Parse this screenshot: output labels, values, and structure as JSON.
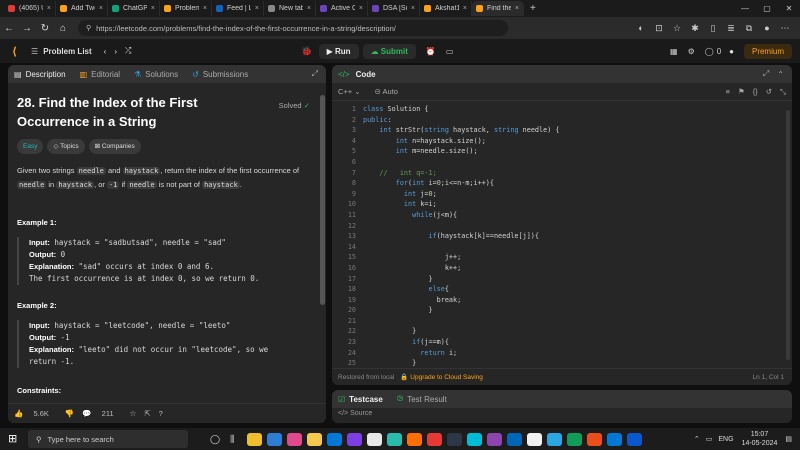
{
  "browser": {
    "tabs": [
      {
        "label": "(4065) US Cl",
        "color": "#e53935"
      },
      {
        "label": "Add Two N",
        "color": "#ffa116"
      },
      {
        "label": "ChatGPT",
        "color": "#10a37f"
      },
      {
        "label": "Problems",
        "color": "#ffa116"
      },
      {
        "label": "Feed | Linke",
        "color": "#0a66c2"
      },
      {
        "label": "New tab",
        "color": "#888888"
      },
      {
        "label": "Active Cou",
        "color": "#6f42c1"
      },
      {
        "label": "DSA [Supe",
        "color": "#6f42c1"
      },
      {
        "label": "Akshat1 Fro",
        "color": "#ffa116"
      },
      {
        "label": "Find the In",
        "color": "#ffa116"
      }
    ],
    "url": "https://leetcode.com/problems/find-the-index-of-the-first-occurrence-in-a-string/description/"
  },
  "header": {
    "problem_list": "Problem List",
    "run": "Run",
    "submit": "Submit",
    "premium": "Premium",
    "count": "0"
  },
  "left_panel": {
    "tabs": [
      "Description",
      "Editorial",
      "Solutions",
      "Submissions"
    ],
    "title": "28. Find the Index of the First Occurrence in a String",
    "solved": "Solved",
    "chips": [
      "Easy",
      "Topics",
      "Companies"
    ],
    "desc_parts": {
      "p1": "Given two strings ",
      "c1": "needle",
      "p2": " and ",
      "c2": "haystack",
      "p3": ", return the index of the first occurrence of ",
      "c3": "needle",
      "p4": " in ",
      "c4": "haystack",
      "p5": ", or ",
      "c5": "-1",
      "p6": " if ",
      "c6": "needle",
      "p7": " is not part of ",
      "c7": "haystack",
      "p8": "."
    },
    "example1": {
      "heading": "Example 1:",
      "input_label": "Input:",
      "input": "haystack = \"sadbutsad\", needle = \"sad\"",
      "output_label": "Output:",
      "output": "0",
      "explanation_label": "Explanation:",
      "explanation": "\"sad\" occurs at index 0 and 6.",
      "explanation2": "The first occurrence is at index 0, so we return 0."
    },
    "example2": {
      "heading": "Example 2:",
      "input_label": "Input:",
      "input": "haystack = \"leetcode\", needle = \"leeto\"",
      "output_label": "Output:",
      "output": "-1",
      "explanation_label": "Explanation:",
      "explanation": "\"leeto\" did not occur in \"leetcode\", so we",
      "explanation2": "return -1."
    },
    "constraints": "Constraints:",
    "likes": "5.6K",
    "comments": "211"
  },
  "code_panel": {
    "tab": "Code",
    "language": "C++",
    "mode": "Auto",
    "lines": [
      "class Solution {",
      "public:",
      "    int strStr(string haystack, string needle) {",
      "        int n=haystack.size();",
      "        int m=needle.size();",
      "",
      "    //   int q=-1;",
      "        for(int i=0;i<=n-m;i++){",
      "          int j=0;",
      "          int k=i;",
      "            while(j<m){",
      "",
      "                if(haystack[k]==needle[j]){",
      "",
      "                    j++;",
      "                    k++;",
      "                }",
      "                else{",
      "                  break;",
      "                }",
      "",
      "            }",
      "            if(j==m){",
      "              return i;",
      "            }"
    ],
    "footer_left": "Restored from local",
    "upgrade": "Upgrade to Cloud Saving",
    "cursor": "Ln 1, Col 1"
  },
  "bottom_panel": {
    "tabs": [
      "Testcase",
      "Test Result"
    ],
    "source": "Source"
  },
  "taskbar": {
    "search_placeholder": "Type here to search",
    "lang": "ENG",
    "time": "15:07",
    "date": "14-05-2024"
  }
}
